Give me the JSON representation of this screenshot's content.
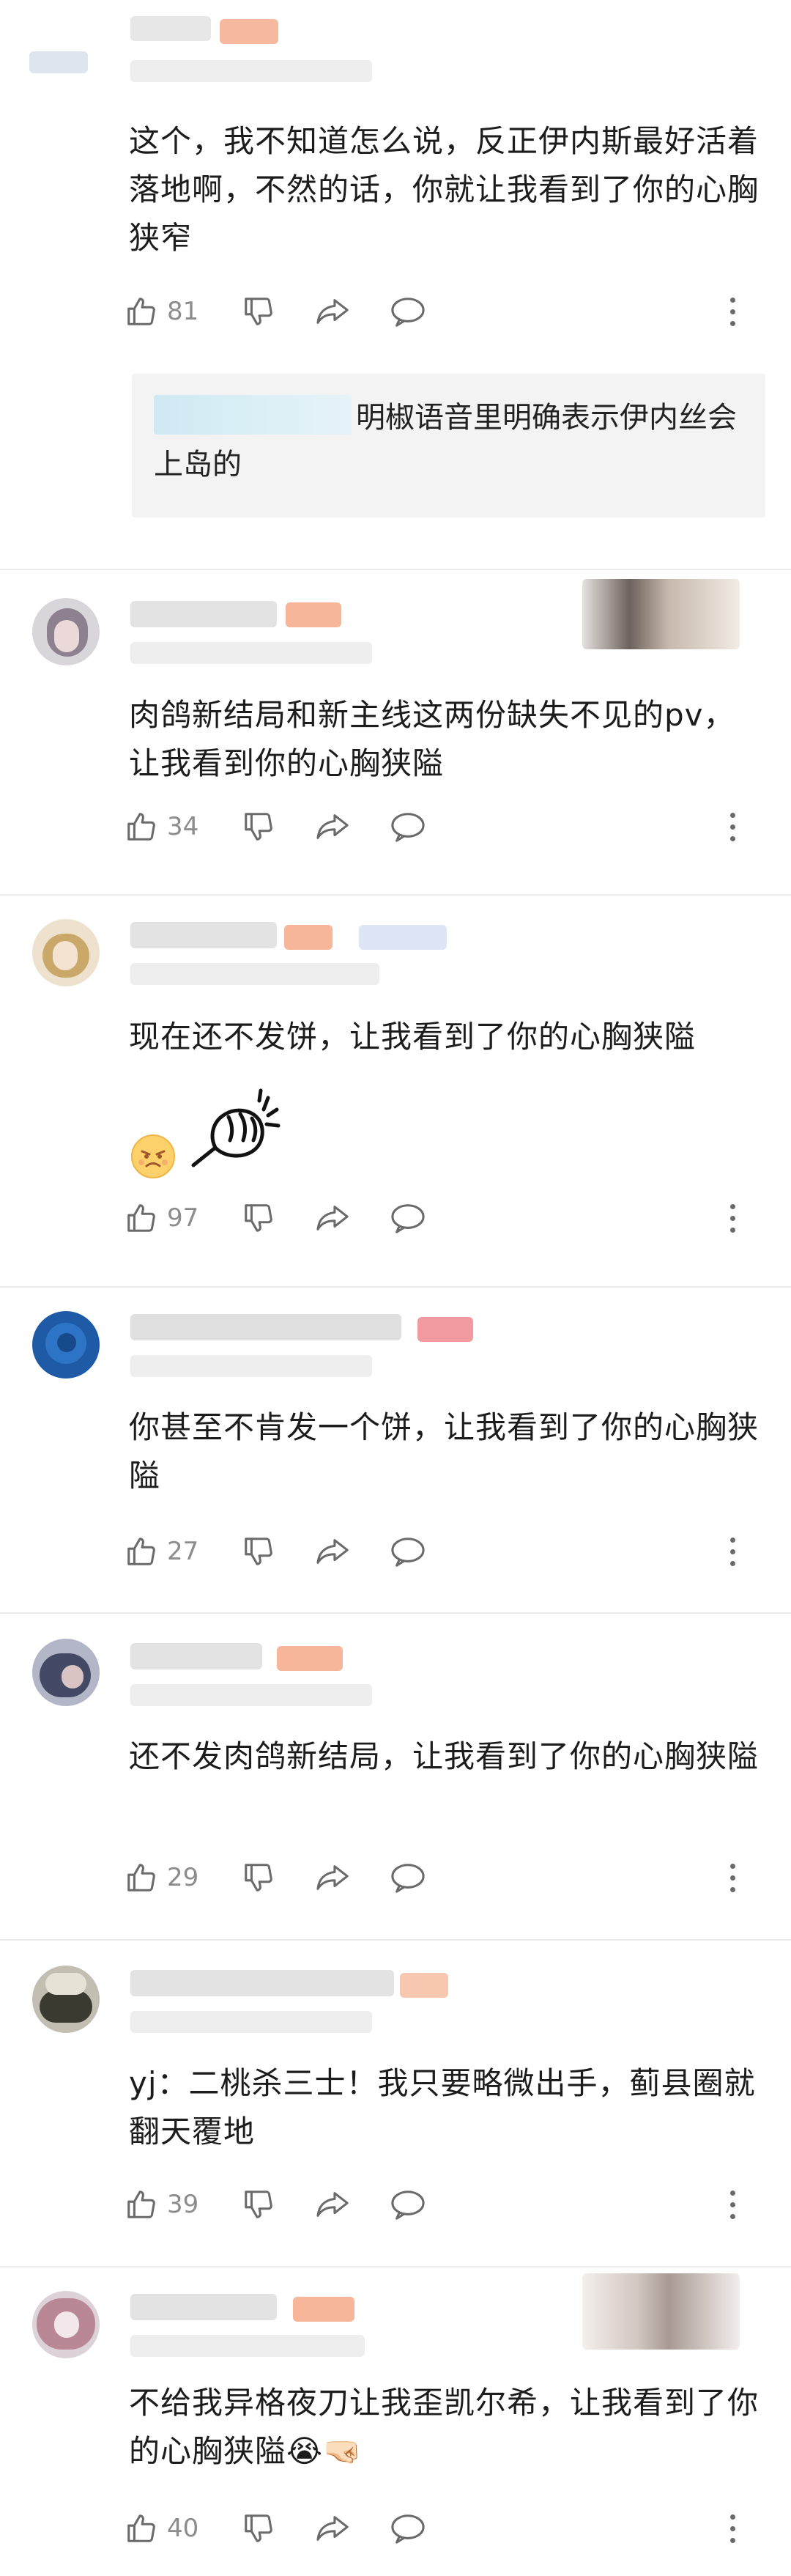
{
  "comments": [
    {
      "text": "这个，我不知道怎么说，反正伊内斯最好活着落地啊，不然的话，你就让我看到了你的心胸狭窄",
      "likes": "81",
      "reply": "明椒语音里明确表示伊内丝会上岛的"
    },
    {
      "text": "肉鸽新结局和新主线这两份缺失不见的pv，让我看到你的心胸狭隘",
      "likes": "34"
    },
    {
      "text": "现在还不发饼，让我看到了你的心胸狭隘",
      "likes": "97",
      "emoji": "angry-face-emoji",
      "sticker": "fist-sticker"
    },
    {
      "text": "你甚至不肯发一个饼，让我看到了你的心胸狭隘",
      "likes": "27"
    },
    {
      "text": "还不发肉鸽新结局，让我看到了你的心胸狭隘",
      "likes": "29"
    },
    {
      "text": "yj：二桃杀三士！我只要略微出手，蓟县圈就翻天覆地",
      "likes": "39"
    },
    {
      "text": "不给我异格夜刀让我歪凯尔希，让我看到了你的心胸狭隘😭🤜🏻",
      "likes": "40"
    }
  ],
  "icons": {
    "like": "thumbs-up-icon",
    "dislike": "thumbs-down-icon",
    "share": "share-icon",
    "reply": "comment-icon",
    "more": "more-vertical-icon"
  },
  "colors": {
    "text": "#1c1c1c",
    "count": "#8c8c8c",
    "divider": "#ececec",
    "reply_bg": "#f3f3f3",
    "icon": "#6a6a6a",
    "badge": "#f6a98a"
  }
}
